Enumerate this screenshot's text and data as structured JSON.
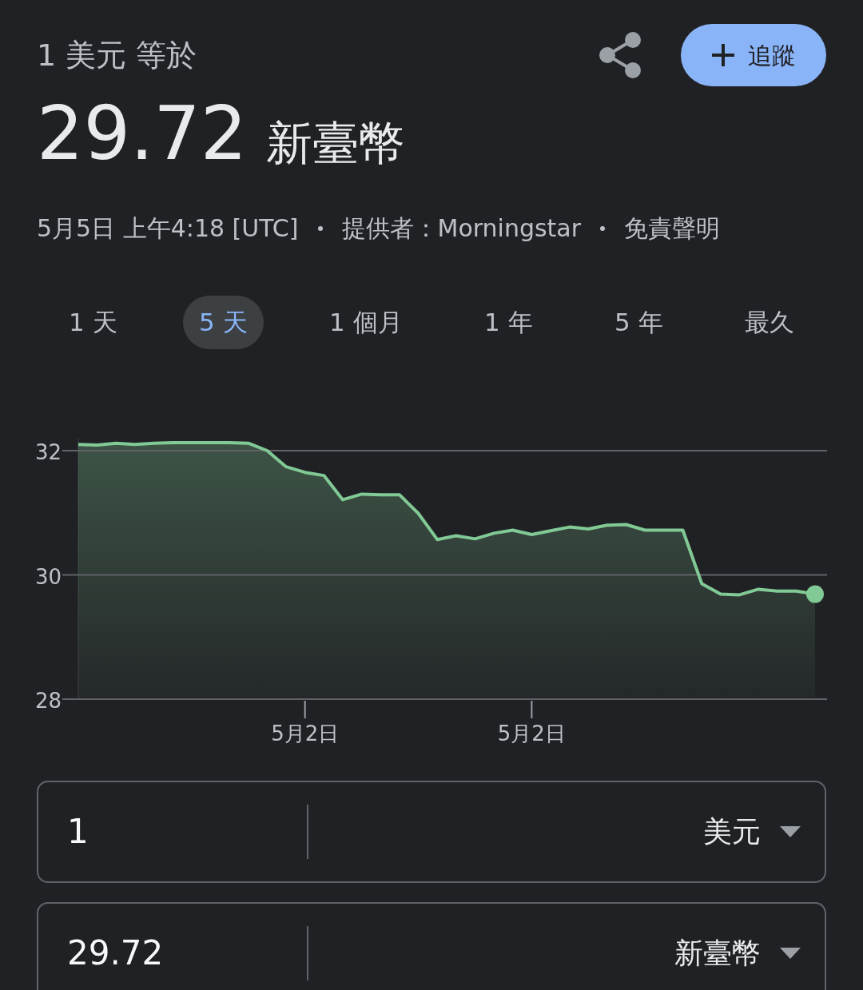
{
  "header": {
    "label": "1 美元 等於",
    "follow_button": {
      "label": "追蹤"
    }
  },
  "rate": {
    "value": "29.72",
    "currency": "新臺幣"
  },
  "source_line": [
    {
      "text": "5月5日 上午4:18 [UTC]"
    },
    {
      "text": "提供者：Morningstar"
    },
    {
      "text": "免責聲明"
    }
  ],
  "range_tabs": [
    {
      "label": "1 天",
      "selected": false
    },
    {
      "label": "5 天",
      "selected": true
    },
    {
      "label": "1 個月",
      "selected": false
    },
    {
      "label": "1 年",
      "selected": false
    },
    {
      "label": "5 年",
      "selected": false
    },
    {
      "label": "最久",
      "selected": false
    }
  ],
  "chart": {
    "chart_data": {
      "type": "area",
      "grid": true,
      "ylim": [
        28,
        32.2
      ],
      "yticks": [
        28,
        30,
        32
      ],
      "categories": [
        null,
        null,
        null,
        null,
        null,
        null,
        null,
        null,
        null,
        null,
        null,
        null,
        "5月2日",
        null,
        null,
        null,
        null,
        null,
        null,
        null,
        null,
        null,
        null,
        null,
        "5月2日",
        null,
        null,
        null,
        null,
        null,
        null,
        null,
        null,
        null,
        null,
        null,
        null,
        null,
        null,
        null
      ],
      "series": [
        {
          "color": "#81c995",
          "values": [
            32.1,
            32.09,
            32.12,
            32.1,
            32.12,
            32.13,
            32.13,
            32.13,
            32.13,
            32.12,
            32.0,
            31.74,
            31.65,
            31.6,
            31.21,
            31.3,
            31.29,
            31.29,
            30.99,
            30.57,
            30.63,
            30.58,
            30.67,
            30.72,
            30.65,
            30.71,
            30.77,
            30.74,
            30.8,
            30.81,
            30.72,
            30.72,
            30.72,
            29.86,
            29.69,
            29.68,
            29.77,
            29.74,
            29.74,
            29.69
          ]
        }
      ]
    }
  },
  "converter": [
    {
      "amount": "1",
      "currency": "美元"
    },
    {
      "amount": "29.72",
      "currency": "新臺幣"
    }
  ]
}
